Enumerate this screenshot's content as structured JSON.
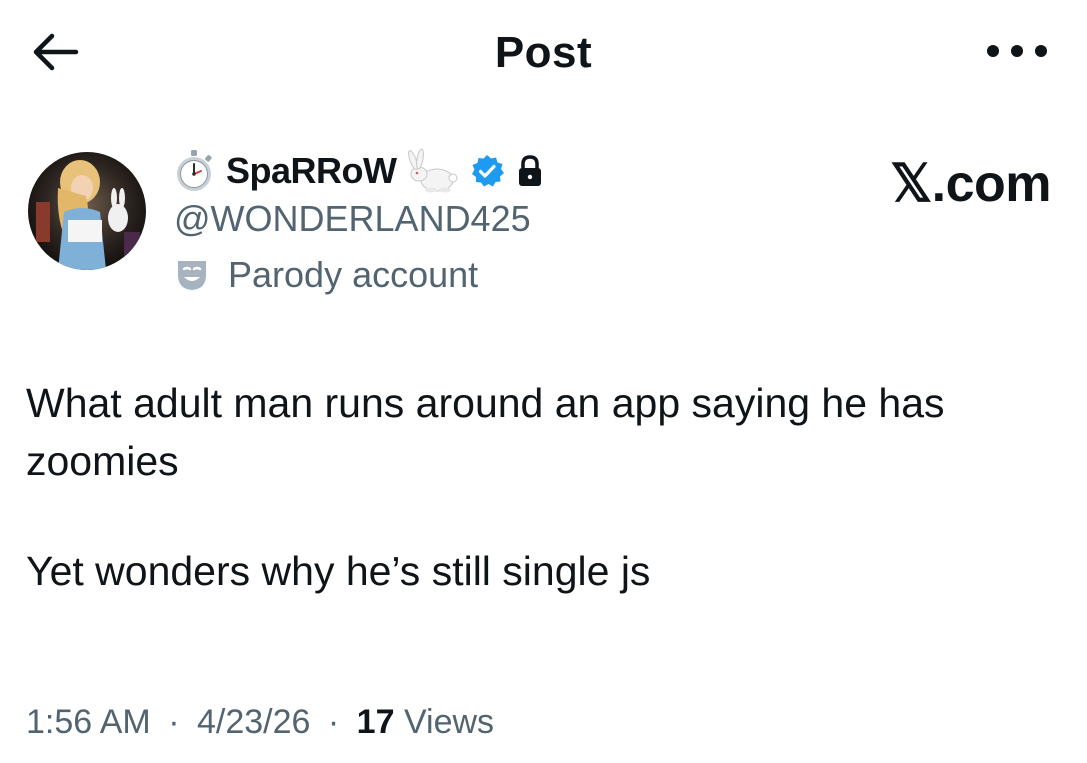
{
  "header": {
    "title": "Post",
    "back_icon": "arrow-left-icon",
    "more_icon": "more-horizontal-icon"
  },
  "author": {
    "avatar_icon": "avatar-alice-wonderland",
    "display_name": "SpaRRoW",
    "name_emoji_prefix": "stopwatch-icon",
    "name_emoji_suffix": "rabbit-icon",
    "verified_icon": "verified-badge-icon",
    "verified_color": "#1d9bf0",
    "lock_icon": "lock-icon",
    "handle": "@WONDERLAND425",
    "label_icon": "parody-mask-icon",
    "label": "Parody account"
  },
  "watermark": "𝕏.com",
  "post": {
    "line1": "What adult man runs around an app saying he has zoomies",
    "line2": "Yet wonders why he’s still single  js"
  },
  "meta": {
    "time": "1:56 AM",
    "date": "4/23/26",
    "separator": "·",
    "views_count": "17",
    "views_label": "Views"
  },
  "colors": {
    "text": "#0f1419",
    "secondary_text": "#536471",
    "background": "#ffffff"
  }
}
